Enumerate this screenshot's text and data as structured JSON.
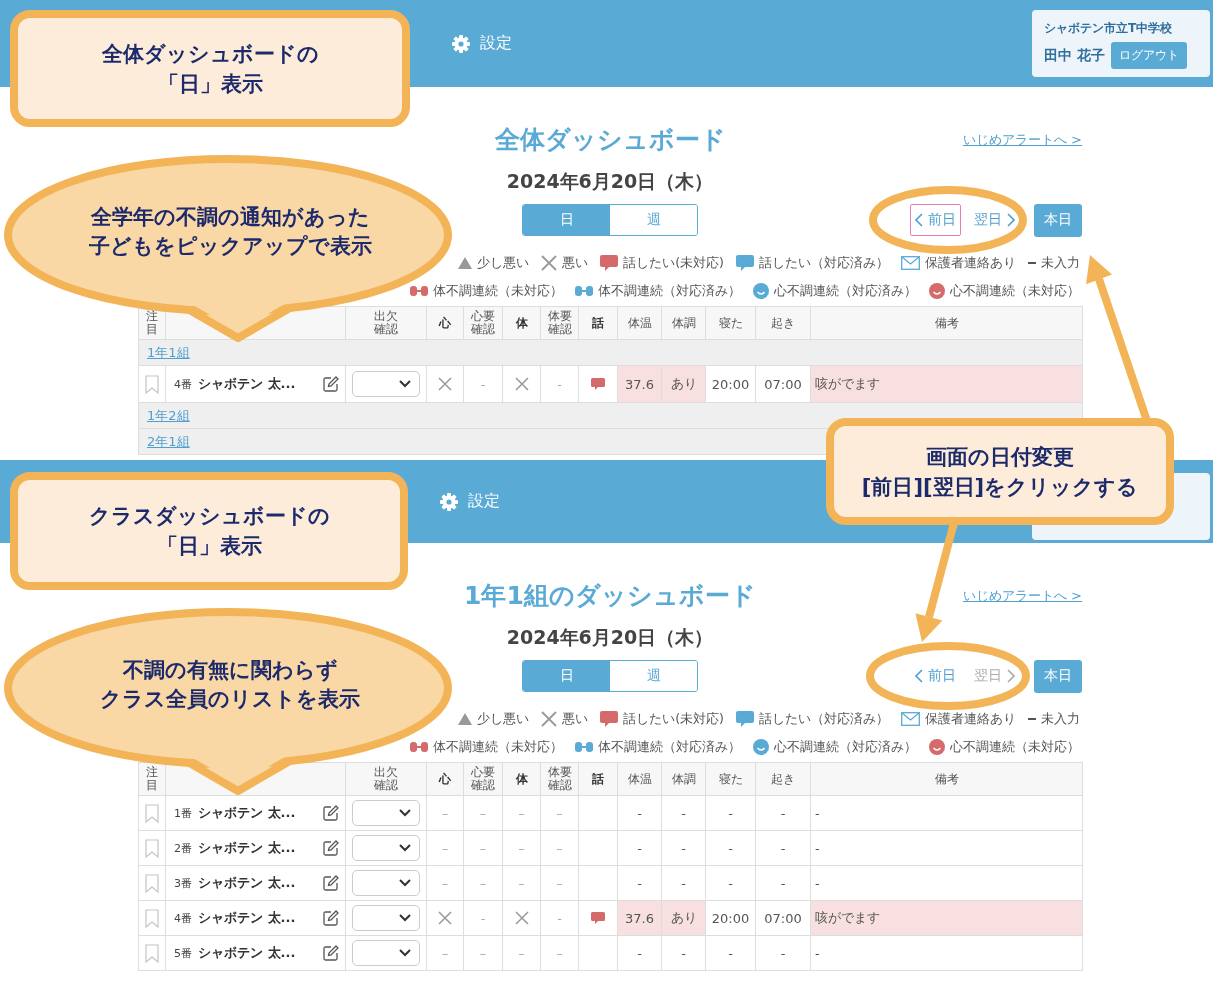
{
  "views": [
    {
      "nav": {
        "settings": "設定",
        "school": "シャボテン市立T中学校",
        "user": "田中 花子",
        "logout": "ログアウト"
      },
      "title": "全体ダッシュボード",
      "alert_link": "いじめアラートへ >",
      "date": "2024年6月20日（木）",
      "tabs": [
        {
          "label": "日",
          "selected": true
        },
        {
          "label": "週",
          "selected": false
        }
      ],
      "date_nav": {
        "prev": "前日",
        "prev_focused": true,
        "next": "翌日",
        "next_disabled": false,
        "today": "本日"
      },
      "legend": [
        [
          {
            "kind": "triangle",
            "label": "少し悪い"
          },
          {
            "kind": "cross",
            "label": "悪い"
          },
          {
            "kind": "chat-red",
            "label": "話したい(未対応)"
          },
          {
            "kind": "chat-blue",
            "label": "話したい（対応済み）"
          },
          {
            "kind": "mail",
            "label": "保護者連絡あり"
          },
          {
            "kind": "dash",
            "label": "未入力"
          }
        ],
        [
          {
            "kind": "body-red",
            "label": "体不調連続（未対応）"
          },
          {
            "kind": "body-blue",
            "label": "体不調連続（対応済み）"
          },
          {
            "kind": "face-blue",
            "label": "心不調連続（対応済み）"
          },
          {
            "kind": "face-red",
            "label": "心不調連続（未対応）"
          }
        ]
      ],
      "table": {
        "columns": [
          {
            "kind": "label",
            "label": "注目",
            "bold": false
          },
          {
            "kind": "blank"
          },
          {
            "kind": "label",
            "label": "出欠確認",
            "bold": false
          },
          {
            "kind": "label",
            "label": "心",
            "bold": true
          },
          {
            "kind": "label",
            "label": "心要確認",
            "bold": false
          },
          {
            "kind": "label",
            "label": "体",
            "bold": true
          },
          {
            "kind": "label",
            "label": "体要確認",
            "bold": false
          },
          {
            "kind": "label",
            "label": "話",
            "bold": true
          },
          {
            "kind": "label",
            "label": "体温",
            "bold": false
          },
          {
            "kind": "label",
            "label": "体調",
            "bold": false
          },
          {
            "kind": "label",
            "label": "寝た",
            "bold": false
          },
          {
            "kind": "label",
            "label": "起き",
            "bold": false
          },
          {
            "kind": "label",
            "label": "備考",
            "bold": false
          }
        ],
        "rows": [
          {
            "kind": "group",
            "label": "1年1組"
          },
          {
            "kind": "student",
            "cells": [
              {
                "kind": "bookmark",
                "alert": false
              },
              {
                "kind": "name",
                "number": "4番",
                "name": "シャボテン 太...",
                "alert": false
              },
              {
                "kind": "select",
                "alert": false
              },
              {
                "kind": "cross",
                "alert": false
              },
              {
                "kind": "text",
                "text": "-",
                "alert": false
              },
              {
                "kind": "cross",
                "alert": false
              },
              {
                "kind": "text",
                "text": "-",
                "alert": false
              },
              {
                "kind": "chat",
                "alert": false
              },
              {
                "kind": "text",
                "text": "37.6",
                "alert": true
              },
              {
                "kind": "text",
                "text": "あり",
                "alert": true
              },
              {
                "kind": "text",
                "text": "20:00",
                "alert": false
              },
              {
                "kind": "text",
                "text": "07:00",
                "alert": false
              },
              {
                "kind": "note",
                "text": "咳がでます",
                "alert": true
              }
            ]
          },
          {
            "kind": "group",
            "label": "1年2組"
          },
          {
            "kind": "group",
            "label": "2年1組"
          }
        ]
      }
    },
    {
      "nav": {
        "settings": "設定"
      },
      "title": "1年1組のダッシュボード",
      "alert_link": "いじめアラートへ >",
      "date": "2024年6月20日（木）",
      "tabs": [
        {
          "label": "日",
          "selected": true
        },
        {
          "label": "週",
          "selected": false
        }
      ],
      "date_nav": {
        "prev": "前日",
        "prev_focused": false,
        "next": "翌日",
        "next_disabled": true,
        "today": "本日"
      },
      "legend": [
        [
          {
            "kind": "triangle",
            "label": "少し悪い"
          },
          {
            "kind": "cross",
            "label": "悪い"
          },
          {
            "kind": "chat-red",
            "label": "話したい(未対応)"
          },
          {
            "kind": "chat-blue",
            "label": "話したい（対応済み）"
          },
          {
            "kind": "mail",
            "label": "保護者連絡あり"
          },
          {
            "kind": "dash",
            "label": "未入力"
          }
        ],
        [
          {
            "kind": "body-red",
            "label": "体不調連続（未対応）"
          },
          {
            "kind": "body-blue",
            "label": "体不調連続（対応済み）"
          },
          {
            "kind": "face-blue",
            "label": "心不調連続（対応済み）"
          },
          {
            "kind": "face-red",
            "label": "心不調連続（未対応）"
          }
        ]
      ],
      "table": {
        "columns": [
          {
            "kind": "label",
            "label": "注目",
            "bold": false
          },
          {
            "kind": "blank"
          },
          {
            "kind": "label",
            "label": "出欠確認",
            "bold": false
          },
          {
            "kind": "label",
            "label": "心",
            "bold": true
          },
          {
            "kind": "label",
            "label": "心要確認",
            "bold": false
          },
          {
            "kind": "label",
            "label": "体",
            "bold": true
          },
          {
            "kind": "label",
            "label": "体要確認",
            "bold": false
          },
          {
            "kind": "label",
            "label": "話",
            "bold": true
          },
          {
            "kind": "label",
            "label": "体温",
            "bold": false
          },
          {
            "kind": "label",
            "label": "体調",
            "bold": false
          },
          {
            "kind": "label",
            "label": "寝た",
            "bold": false
          },
          {
            "kind": "label",
            "label": "起き",
            "bold": false
          },
          {
            "kind": "label",
            "label": "備考",
            "bold": false
          }
        ],
        "rows": [
          {
            "kind": "student",
            "cells": [
              {
                "kind": "bookmark",
                "alert": false
              },
              {
                "kind": "name",
                "number": "1番",
                "name": "シャボテン 太...",
                "alert": false
              },
              {
                "kind": "select",
                "alert": false
              },
              {
                "kind": "text",
                "text": "–",
                "alert": false
              },
              {
                "kind": "text",
                "text": "–",
                "alert": false
              },
              {
                "kind": "text",
                "text": "–",
                "alert": false
              },
              {
                "kind": "text",
                "text": "–",
                "alert": false
              },
              {
                "kind": "empty",
                "alert": false
              },
              {
                "kind": "text",
                "text": "-",
                "alert": false
              },
              {
                "kind": "text",
                "text": "-",
                "alert": false
              },
              {
                "kind": "text",
                "text": "-",
                "alert": false
              },
              {
                "kind": "text",
                "text": "-",
                "alert": false
              },
              {
                "kind": "note",
                "text": "-",
                "alert": false
              }
            ]
          },
          {
            "kind": "student",
            "cells": [
              {
                "kind": "bookmark",
                "alert": false
              },
              {
                "kind": "name",
                "number": "2番",
                "name": "シャボテン 太...",
                "alert": false
              },
              {
                "kind": "select",
                "alert": false
              },
              {
                "kind": "text",
                "text": "–",
                "alert": false
              },
              {
                "kind": "text",
                "text": "–",
                "alert": false
              },
              {
                "kind": "text",
                "text": "–",
                "alert": false
              },
              {
                "kind": "text",
                "text": "–",
                "alert": false
              },
              {
                "kind": "empty",
                "alert": false
              },
              {
                "kind": "text",
                "text": "-",
                "alert": false
              },
              {
                "kind": "text",
                "text": "-",
                "alert": false
              },
              {
                "kind": "text",
                "text": "-",
                "alert": false
              },
              {
                "kind": "text",
                "text": "-",
                "alert": false
              },
              {
                "kind": "note",
                "text": "-",
                "alert": false
              }
            ]
          },
          {
            "kind": "student",
            "cells": [
              {
                "kind": "bookmark",
                "alert": false
              },
              {
                "kind": "name",
                "number": "3番",
                "name": "シャボテン 太...",
                "alert": false
              },
              {
                "kind": "select",
                "alert": false
              },
              {
                "kind": "text",
                "text": "–",
                "alert": false
              },
              {
                "kind": "text",
                "text": "–",
                "alert": false
              },
              {
                "kind": "text",
                "text": "–",
                "alert": false
              },
              {
                "kind": "text",
                "text": "–",
                "alert": false
              },
              {
                "kind": "empty",
                "alert": false
              },
              {
                "kind": "text",
                "text": "-",
                "alert": false
              },
              {
                "kind": "text",
                "text": "-",
                "alert": false
              },
              {
                "kind": "text",
                "text": "-",
                "alert": false
              },
              {
                "kind": "text",
                "text": "-",
                "alert": false
              },
              {
                "kind": "note",
                "text": "-",
                "alert": false
              }
            ]
          },
          {
            "kind": "student",
            "cells": [
              {
                "kind": "bookmark",
                "alert": false
              },
              {
                "kind": "name",
                "number": "4番",
                "name": "シャボテン 太...",
                "alert": false
              },
              {
                "kind": "select",
                "alert": false
              },
              {
                "kind": "cross",
                "alert": false
              },
              {
                "kind": "text",
                "text": "-",
                "alert": false
              },
              {
                "kind": "cross",
                "alert": false
              },
              {
                "kind": "text",
                "text": "-",
                "alert": false
              },
              {
                "kind": "chat",
                "alert": false
              },
              {
                "kind": "text",
                "text": "37.6",
                "alert": true
              },
              {
                "kind": "text",
                "text": "あり",
                "alert": true
              },
              {
                "kind": "text",
                "text": "20:00",
                "alert": false
              },
              {
                "kind": "text",
                "text": "07:00",
                "alert": false
              },
              {
                "kind": "note",
                "text": "咳がでます",
                "alert": true
              }
            ]
          },
          {
            "kind": "student",
            "cells": [
              {
                "kind": "bookmark",
                "alert": false
              },
              {
                "kind": "name",
                "number": "5番",
                "name": "シャボテン 太...",
                "alert": false
              },
              {
                "kind": "select",
                "alert": false
              },
              {
                "kind": "text",
                "text": "–",
                "alert": false
              },
              {
                "kind": "text",
                "text": "–",
                "alert": false
              },
              {
                "kind": "text",
                "text": "–",
                "alert": false
              },
              {
                "kind": "text",
                "text": "–",
                "alert": false
              },
              {
                "kind": "empty",
                "alert": false
              },
              {
                "kind": "text",
                "text": "-",
                "alert": false
              },
              {
                "kind": "text",
                "text": "-",
                "alert": false
              },
              {
                "kind": "text",
                "text": "-",
                "alert": false
              },
              {
                "kind": "text",
                "text": "-",
                "alert": false
              },
              {
                "kind": "note",
                "text": "-",
                "alert": false
              }
            ]
          }
        ]
      }
    }
  ],
  "callouts": [
    {
      "kind": "box",
      "lines": [
        "全体ダッシュボードの",
        "「日」表示"
      ]
    },
    {
      "kind": "bubble",
      "lines": [
        "全学年の不調の通知があった",
        "子どもをピックアップで表示"
      ]
    },
    {
      "kind": "box",
      "lines": [
        "画面の日付変更",
        "[前日][翌日]をクリックする"
      ]
    },
    {
      "kind": "box",
      "lines": [
        "クラスダッシュボードの",
        "「日」表示"
      ]
    },
    {
      "kind": "bubble",
      "lines": [
        "不調の有無に関わらず",
        "クラス全員のリストを表示"
      ]
    }
  ]
}
